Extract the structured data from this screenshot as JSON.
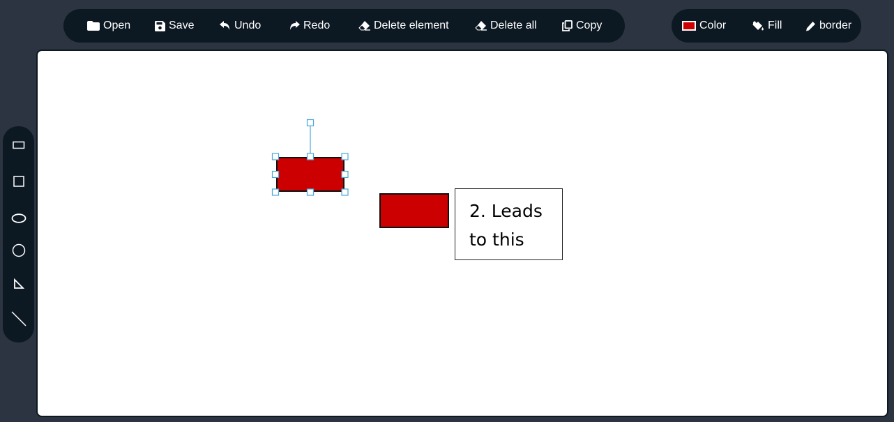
{
  "toolbar": {
    "open_label": "Open",
    "save_label": "Save",
    "undo_label": "Undo",
    "redo_label": "Redo",
    "delete_element_label": "Delete element",
    "delete_all_label": "Delete all",
    "copy_label": "Copy"
  },
  "style_toolbar": {
    "color_label": "Color",
    "fill_label": "Fill",
    "border_label": "border",
    "current_color": "#cc0000"
  },
  "palette": {
    "tools": [
      {
        "name": "rectangle",
        "icon": "rectangle-icon"
      },
      {
        "name": "square",
        "icon": "square-icon"
      },
      {
        "name": "ellipse",
        "icon": "ellipse-icon"
      },
      {
        "name": "circle",
        "icon": "circle-icon"
      },
      {
        "name": "triangle",
        "icon": "right-triangle-icon"
      },
      {
        "name": "line",
        "icon": "line-icon"
      }
    ]
  },
  "canvas": {
    "shape_fill": "#cc0000",
    "selection_color": "#4aa8d8",
    "annotation_text": "2. Leads to this"
  }
}
